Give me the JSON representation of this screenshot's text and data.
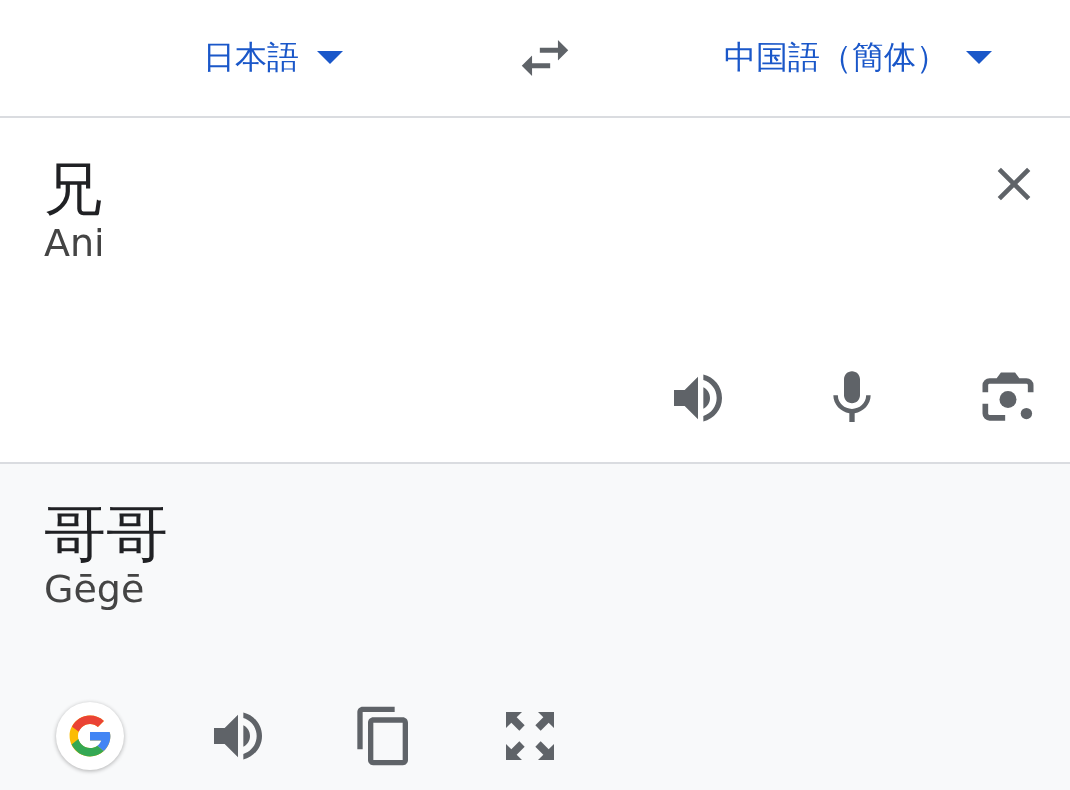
{
  "languages": {
    "source": {
      "label": "日本語"
    },
    "target": {
      "label": "中国語（簡体）"
    }
  },
  "input": {
    "text": "兄",
    "romanization": "Ani"
  },
  "output": {
    "text": "哥哥",
    "romanization": "Gēgē"
  }
}
